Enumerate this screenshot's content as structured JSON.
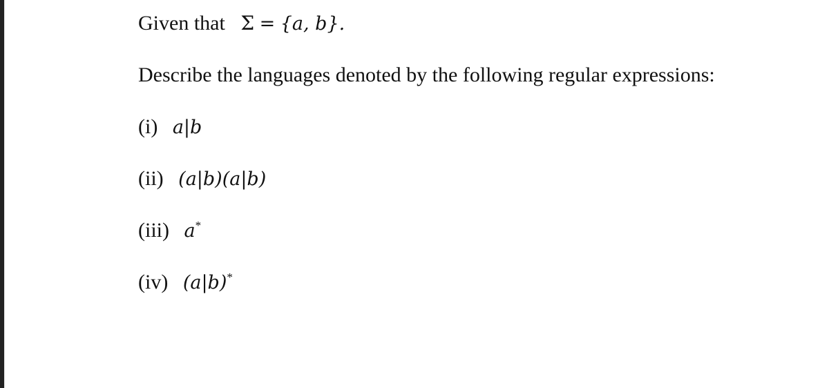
{
  "intro": {
    "prefix": "Given that",
    "set_symbol": "Σ",
    "equals": "=",
    "set_value": "{a, b}."
  },
  "instruction": "Describe the languages denoted by the following regular expressions:",
  "items": [
    {
      "label": "(i)",
      "expr": "a|b"
    },
    {
      "label": "(ii)",
      "expr": "(a|b)(a|b)"
    },
    {
      "label": "(iii)",
      "expr": "a",
      "sup": "*"
    },
    {
      "label": "(iv)",
      "expr": "(a|b)",
      "sup": "*"
    }
  ]
}
